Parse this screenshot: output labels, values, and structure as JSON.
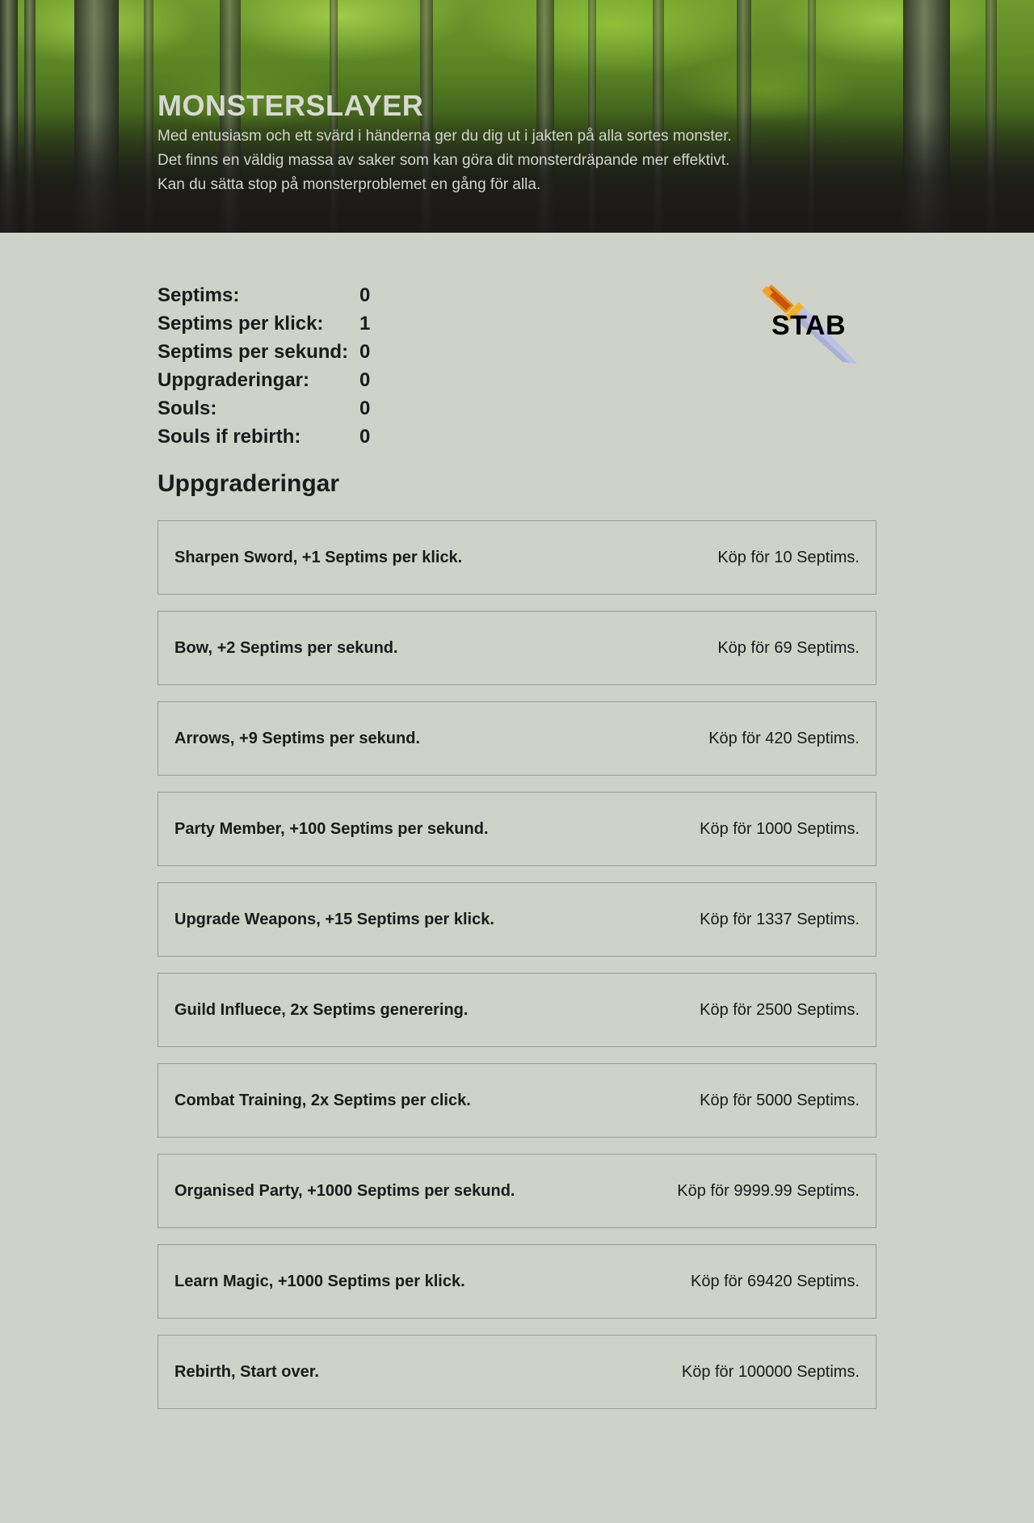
{
  "header": {
    "title": "MONSTERSLAYER",
    "description": [
      "Med entusiasm och ett svärd i händerna ger du dig ut i jakten på alla sortes monster.",
      "Det finns en väldig massa av saker som kan göra dit monsterdräpande mer effektivt.",
      "Kan du sätta stop på monsterproblemet en gång för alla."
    ]
  },
  "stats": [
    {
      "label": "Septims:",
      "value": "0"
    },
    {
      "label": "Septims per klick:",
      "value": "1"
    },
    {
      "label": "Septims per sekund:",
      "value": "0"
    },
    {
      "label": "Uppgraderingar:",
      "value": "0"
    },
    {
      "label": "Souls:",
      "value": "0"
    },
    {
      "label": "Souls if rebirth:",
      "value": "0"
    }
  ],
  "stab_button": {
    "label": "STAB",
    "icon": "sword-icon"
  },
  "upgrades_title": "Uppgraderingar",
  "upgrades": [
    {
      "name": "Sharpen Sword, +1 Septims per klick.",
      "price": "Köp för 10 Septims."
    },
    {
      "name": "Bow, +2 Septims per sekund.",
      "price": "Köp för 69 Septims."
    },
    {
      "name": "Arrows, +9 Septims per sekund.",
      "price": "Köp för 420 Septims."
    },
    {
      "name": "Party Member, +100 Septims per sekund.",
      "price": "Köp för 1000 Septims."
    },
    {
      "name": "Upgrade Weapons, +15 Septims per klick.",
      "price": "Köp för 1337 Septims."
    },
    {
      "name": "Guild Influece, 2x Septims generering.",
      "price": "Köp för 2500 Septims."
    },
    {
      "name": "Combat Training, 2x Septims per click.",
      "price": "Köp för 5000 Septims."
    },
    {
      "name": "Organised Party, +1000 Septims per sekund.",
      "price": "Köp för 9999.99 Septims."
    },
    {
      "name": "Learn Magic, +1000 Septims per klick.",
      "price": "Köp för 69420 Septims."
    },
    {
      "name": "Rebirth, Start over.",
      "price": "Köp för 100000 Septims."
    }
  ],
  "colors": {
    "background": "#cfd2c9",
    "text": "#161616",
    "border": "#9a9c96",
    "sword_handle": "#e88a10",
    "sword_blade": "#a9acd6"
  }
}
